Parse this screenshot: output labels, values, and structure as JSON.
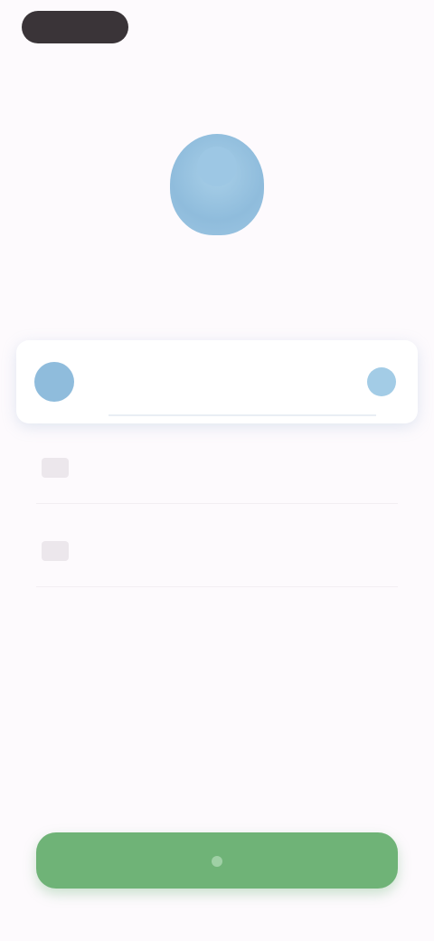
{
  "status_pill": {
    "label": ""
  },
  "header": {
    "title": "",
    "subtitle": ""
  },
  "options": {
    "selected": {
      "label": ""
    },
    "items": [
      {
        "label": ""
      },
      {
        "label": ""
      }
    ]
  },
  "primary_button": {
    "label": ""
  },
  "colors": {
    "accent_green": "#6fb377",
    "accent_blue": "#8fbcdc",
    "background": "#fdfafd"
  }
}
